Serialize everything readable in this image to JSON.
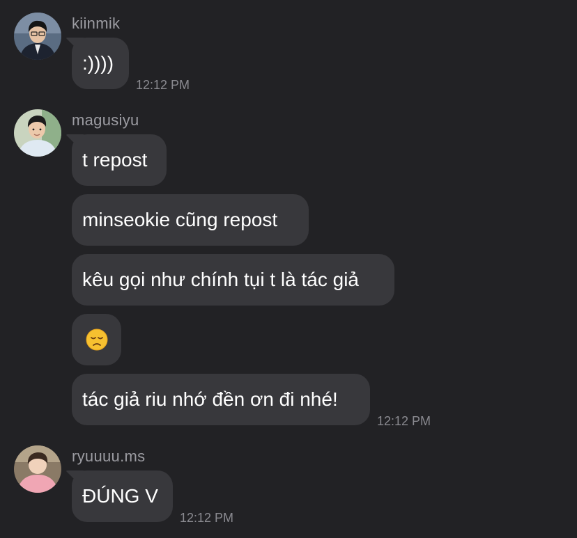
{
  "messages": [
    {
      "username": "kiinmik",
      "avatar_icon": "avatar-kiinmik-icon",
      "bubbles": [
        ":))))"
      ],
      "time": "12:12 PM"
    },
    {
      "username": "magusiyu",
      "avatar_icon": "avatar-magusiyu-icon",
      "bubbles": [
        "t repost",
        "minseokie cũng repost",
        "kêu gọi như chính tụi t là tác giả",
        "disappointed-face-emoji",
        "tác giả riu nhớ đền ơn đi nhé!"
      ],
      "time": "12:12 PM"
    },
    {
      "username": "ryuuuu.ms",
      "avatar_icon": "avatar-ryuuuu-icon",
      "bubbles": [
        "ĐÚNG V"
      ],
      "time": "12:12 PM"
    }
  ],
  "colors": {
    "background": "#222225",
    "bubble": "#38383c",
    "username": "#9c9ca2",
    "timestamp": "#8a8a90",
    "emoji_face": "#f6c030"
  }
}
